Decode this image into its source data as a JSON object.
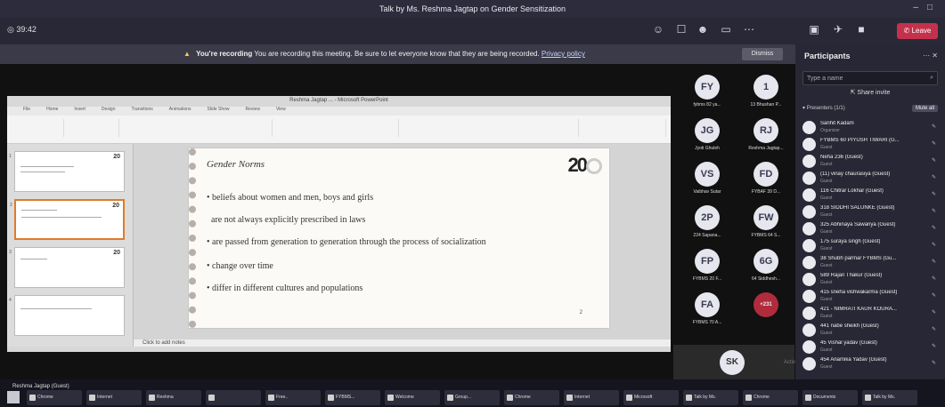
{
  "window": {
    "title": "Talk by Ms. Reshma Jagtap on Gender Sensitization"
  },
  "toolbar": {
    "timer": "39:42",
    "leave_label": "Leave"
  },
  "recording_bar": {
    "label": "You're recording",
    "message": "You are recording this meeting. Be sure to let everyone know that they are being recorded.",
    "link": "Privacy policy",
    "dismiss": "Dismiss"
  },
  "ppt": {
    "title": "Reshma Jagtap ... - Microsoft PowerPoint",
    "tabs": [
      "File",
      "Home",
      "Insert",
      "Design",
      "Transitions",
      "Animations",
      "Slide Show",
      "Review",
      "View"
    ],
    "notes_placeholder": "Click to add notes"
  },
  "slide": {
    "title": "Gender Norms",
    "logo": "20",
    "bullets": [
      "beliefs about women and men, boys and girls",
      "are not always explicitly prescribed in laws",
      "are passed from generation to generation through the process of socialization",
      "change over time",
      "differ in different cultures and populations"
    ],
    "number": "2"
  },
  "tiles": [
    {
      "initials": "FY",
      "name": "fybms 82 ya..."
    },
    {
      "initials": "1",
      "name": "13 Bhushan P..."
    },
    {
      "initials": "JG",
      "name": "Jyoti Ghuleh"
    },
    {
      "initials": "RJ",
      "name": "Reshma Jagtap..."
    },
    {
      "initials": "VS",
      "name": "Vaibhav Sutar"
    },
    {
      "initials": "FD",
      "name": "FYBAF 39 D..."
    },
    {
      "initials": "2P",
      "name": "224 Sapana..."
    },
    {
      "initials": "FW",
      "name": "FYBMS 64 S..."
    },
    {
      "initials": "FP",
      "name": "FYBMS 20 F..."
    },
    {
      "initials": "6G",
      "name": "64 Siddhesh..."
    },
    {
      "initials": "FA",
      "name": "FYBMS 70 A..."
    },
    {
      "initials": "+231",
      "name": ""
    }
  ],
  "self_tile": {
    "initials": "SK"
  },
  "participants": {
    "header": "Participants",
    "search_placeholder": "Type a name",
    "share_invite": "Share invite",
    "section": "Presenters (1/1)",
    "mute_all": "Mute all",
    "people": [
      {
        "name": "Sanhit Kadam",
        "role": "Organizer"
      },
      {
        "name": "FYBMS 60 PIYUSH TIWARI (G...",
        "role": "Guest"
      },
      {
        "name": "Neha 236 (Guest)",
        "role": "Guest"
      },
      {
        "name": "(11) vinay chaurasiya (Guest)",
        "role": "Guest"
      },
      {
        "name": "116 Chitrar Lokhar (Guest)",
        "role": "Guest"
      },
      {
        "name": "318 SIDDHI SALUNKE (Guest)",
        "role": "Guest"
      },
      {
        "name": "325 Abhinaya Sawariya (Guest)",
        "role": "Guest"
      },
      {
        "name": "175 suraya singh (Guest)",
        "role": "Guest"
      },
      {
        "name": "38 Shubh parmar FYBMS (Gu...",
        "role": "Guest"
      },
      {
        "name": "589 Rajan Thakur (Guest)",
        "role": "Guest"
      },
      {
        "name": "415 sneha vishwakarma (Guest)",
        "role": "Guest"
      },
      {
        "name": "421 - NIMRATI KAUR KOURA...",
        "role": "Guest"
      },
      {
        "name": "441 nabe sheikh (Guest)",
        "role": "Guest"
      },
      {
        "name": "45 Vishal yadav (Guest)",
        "role": "Guest"
      },
      {
        "name": "454 Anamika Yadav (Guest)",
        "role": "Guest"
      }
    ]
  },
  "status_name": "Reshma Jagtap (Guest)",
  "activate": "Activate Windows",
  "taskbar": [
    "Chrome",
    "Internet",
    "Reshma",
    "",
    "Free..",
    "FYBMS...",
    "Welcome",
    "Group...",
    "Chrome",
    "Internet",
    "Microsoft",
    "Talk by Ms.",
    "Chrome",
    "Documents",
    "Talk by Ms."
  ]
}
